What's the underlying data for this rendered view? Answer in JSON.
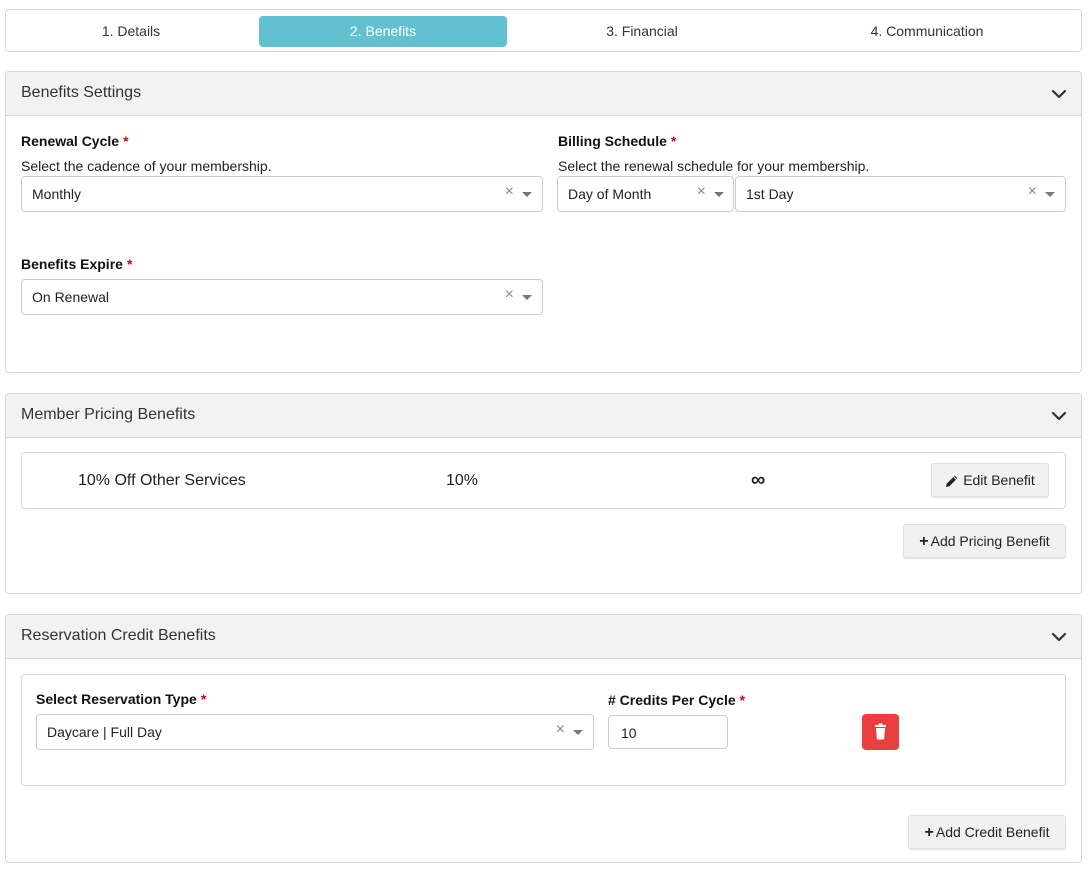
{
  "steps": [
    {
      "label": "1. Details",
      "active": false
    },
    {
      "label": "2. Benefits",
      "active": true
    },
    {
      "label": "3. Financial",
      "active": false
    },
    {
      "label": "4. Communication",
      "active": false
    }
  ],
  "benefits_settings": {
    "title": "Benefits Settings",
    "renewal_cycle": {
      "label": "Renewal Cycle",
      "required_mark": "*",
      "help": "Select the cadence of your membership.",
      "value": "Monthly"
    },
    "billing_schedule": {
      "label": "Billing Schedule",
      "required_mark": "*",
      "help": "Select the renewal schedule for your membership.",
      "type_value": "Day of Month",
      "day_value": "1st Day"
    },
    "benefits_expire": {
      "label": "Benefits Expire",
      "required_mark": "*",
      "value": "On Renewal"
    }
  },
  "member_pricing": {
    "title": "Member Pricing Benefits",
    "rows": [
      {
        "name": "10% Off Other Services",
        "discount": "10%",
        "limit": "∞",
        "edit_label": "Edit Benefit"
      }
    ],
    "add_label": "Add Pricing Benefit"
  },
  "reservation_credits": {
    "title": "Reservation Credit Benefits",
    "type_label": "Select Reservation Type",
    "type_required_mark": "*",
    "type_value": "Daycare | Full Day",
    "credits_label": "# Credits Per Cycle",
    "credits_required_mark": "*",
    "credits_value": "10",
    "add_label": "Add Credit Benefit"
  },
  "icons": {
    "clear": "×",
    "plus": "+",
    "chevron": "chevron-down-icon",
    "pencil": "pencil-icon",
    "trash": "trash-icon"
  },
  "colors": {
    "active_step": "#62c1d1",
    "required": "#d0021b",
    "delete": "#e93f3f"
  }
}
